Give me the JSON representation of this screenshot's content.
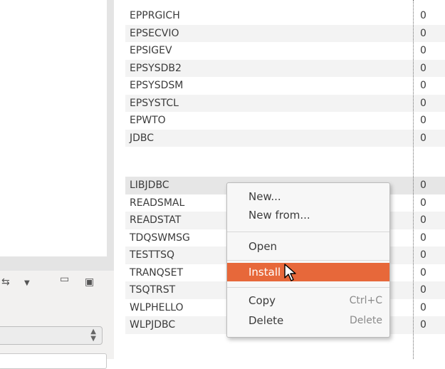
{
  "table": {
    "partial_top": "·",
    "rows": [
      {
        "name": "EPPRGICH",
        "value": "0"
      },
      {
        "name": "EPSECVIO",
        "value": "0"
      },
      {
        "name": "EPSIGEV",
        "value": "0"
      },
      {
        "name": "EPSYSDB2",
        "value": "0"
      },
      {
        "name": "EPSYSDSM",
        "value": "0"
      },
      {
        "name": "EPSYSTCL",
        "value": "0"
      },
      {
        "name": "EPWTO",
        "value": "0"
      },
      {
        "name": "JDBC",
        "value": "0"
      },
      {
        "name": "LIBJDBC",
        "value": "0"
      },
      {
        "name": "READSMAL",
        "value": "0"
      },
      {
        "name": "READSTAT",
        "value": "0"
      },
      {
        "name": "TDQSWMSG",
        "value": "0"
      },
      {
        "name": "TESTTSQ",
        "value": "0"
      },
      {
        "name": "TRANQSET",
        "value": "0"
      },
      {
        "name": "TSQTRST",
        "value": "0"
      },
      {
        "name": "WLPHELLO",
        "value": "0"
      },
      {
        "name": "WLPJDBC",
        "value": "0"
      }
    ]
  },
  "context_menu": {
    "new_label": "New...",
    "new_from_label": "New from...",
    "open_label": "Open",
    "install_label": "Install",
    "copy_label": "Copy",
    "copy_shortcut": "Ctrl+C",
    "delete_label": "Delete",
    "delete_shortcut": "Delete"
  },
  "left_panel": {
    "toolbar_icons": [
      "sync-icon",
      "dropdown-arrow-icon",
      "minimize-icon",
      "maximize-icon"
    ]
  },
  "colors": {
    "highlight": "#e7683a",
    "selected_row": "#e6e6e6"
  }
}
